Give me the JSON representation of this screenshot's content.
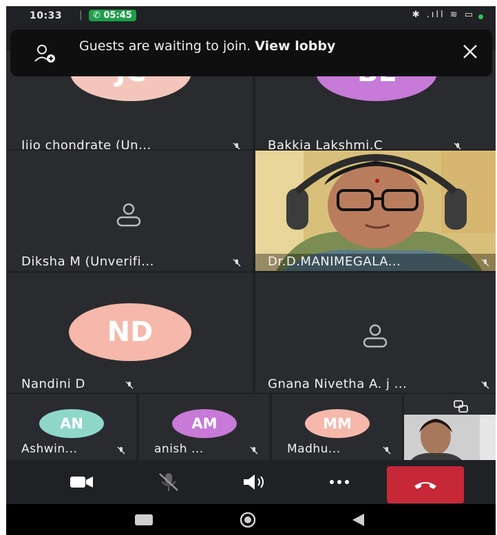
{
  "status_bar": {
    "time": "10:33",
    "separator": "|",
    "call_duration": "05:45",
    "status_icons": "✱ .ıll ≋ ▭",
    "status_dot_color": "#2fc45a"
  },
  "banner": {
    "message": "Guests are waiting to join.",
    "link": "View lobby",
    "icon": "people-add-icon",
    "close_icon": "close-icon"
  },
  "participants": [
    {
      "name": "Jijo chondrate (Un...",
      "initials": "JC",
      "avatar_color": "#f4c6bb",
      "type": "avatar",
      "muted": true
    },
    {
      "name": "Bakkia Lakshmi.C",
      "initials": "BL",
      "avatar_color": "#c77ad8",
      "type": "avatar",
      "muted": true
    },
    {
      "name": "Diksha M  (Unverifi...",
      "initials": "",
      "type": "placeholder",
      "muted": true
    },
    {
      "name": "Dr.D.MANIMEGALA...",
      "initials": "",
      "type": "video",
      "muted": true
    },
    {
      "name": "Nandini D",
      "initials": "ND",
      "avatar_color": "#f5b8aa",
      "type": "avatar",
      "muted": true
    },
    {
      "name": "Gnana Nivetha A. j ...",
      "initials": "",
      "type": "placeholder",
      "muted": true
    }
  ],
  "small_tiles": [
    {
      "name": "Ashwin...",
      "initials": "AN",
      "avatar_color": "#8fd8c8",
      "muted": true
    },
    {
      "name": "anish ...",
      "initials": "AM",
      "avatar_color": "#c77ad8",
      "muted": true
    },
    {
      "name": "Madhu...",
      "initials": "MM",
      "avatar_color": "#f5b8aa",
      "muted": true
    }
  ],
  "self_view": {
    "switch_camera_icon": "switch-camera-icon"
  },
  "toolbar": {
    "camera": "video-camera-icon",
    "mic": "mic-off-icon",
    "speaker": "speaker-icon",
    "more": "more-icon",
    "end_call": "end-call-icon",
    "end_call_color": "#c62838"
  },
  "nav": {
    "recents": "recents-icon",
    "home": "home-icon",
    "back": "back-icon"
  }
}
